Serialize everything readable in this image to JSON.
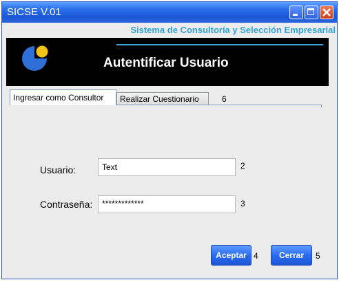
{
  "window": {
    "title": "SICSE V.01"
  },
  "header": {
    "subtitle": "Sistema de Consultoría y Selección Empresarial"
  },
  "banner": {
    "title": "Autentificar Usuario"
  },
  "tabs": [
    {
      "label": "Ingresar como Consultor",
      "active": true
    },
    {
      "label": "Realizar Cuestionario",
      "active": false
    }
  ],
  "tabs_number": "6",
  "form": {
    "username_label": "Usuario:",
    "username_value": "Text",
    "username_number": "2",
    "password_label": "Contraseña:",
    "password_value": "*************",
    "password_number": "3"
  },
  "buttons": {
    "accept_label": "Aceptar",
    "accept_number": "4",
    "close_label": "Cerrar",
    "close_number": "5"
  },
  "colors": {
    "titlebar": "#2a6de8",
    "accent": "#33a3d6",
    "banner_bg": "#000000",
    "button": "#2a6cf0"
  }
}
